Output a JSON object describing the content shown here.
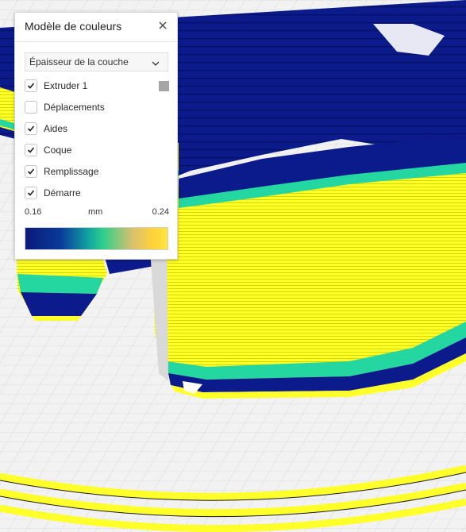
{
  "panel": {
    "title": "Modèle de couleurs",
    "dropdown": {
      "selected": "Épaisseur de la couche"
    },
    "options": [
      {
        "label": "Extruder 1",
        "checked": true,
        "swatch": "#a6a6a6"
      },
      {
        "label": "Déplacements",
        "checked": false
      },
      {
        "label": "Aides",
        "checked": true
      },
      {
        "label": "Coque",
        "checked": true
      },
      {
        "label": "Remplissage",
        "checked": true
      },
      {
        "label": "Démarre",
        "checked": true
      }
    ],
    "scale": {
      "min": "0.16",
      "unit": "mm",
      "max": "0.24"
    },
    "gradient_colors": [
      "#0a1a7a",
      "#12a7a0",
      "#2fd08a",
      "#d8c070",
      "#ffe640"
    ]
  },
  "colors": {
    "layer_blue": "#0b1b8c",
    "layer_yellow": "#ffff2a",
    "layer_green": "#24d6a0",
    "grid_bg": "#f2f2f2"
  }
}
